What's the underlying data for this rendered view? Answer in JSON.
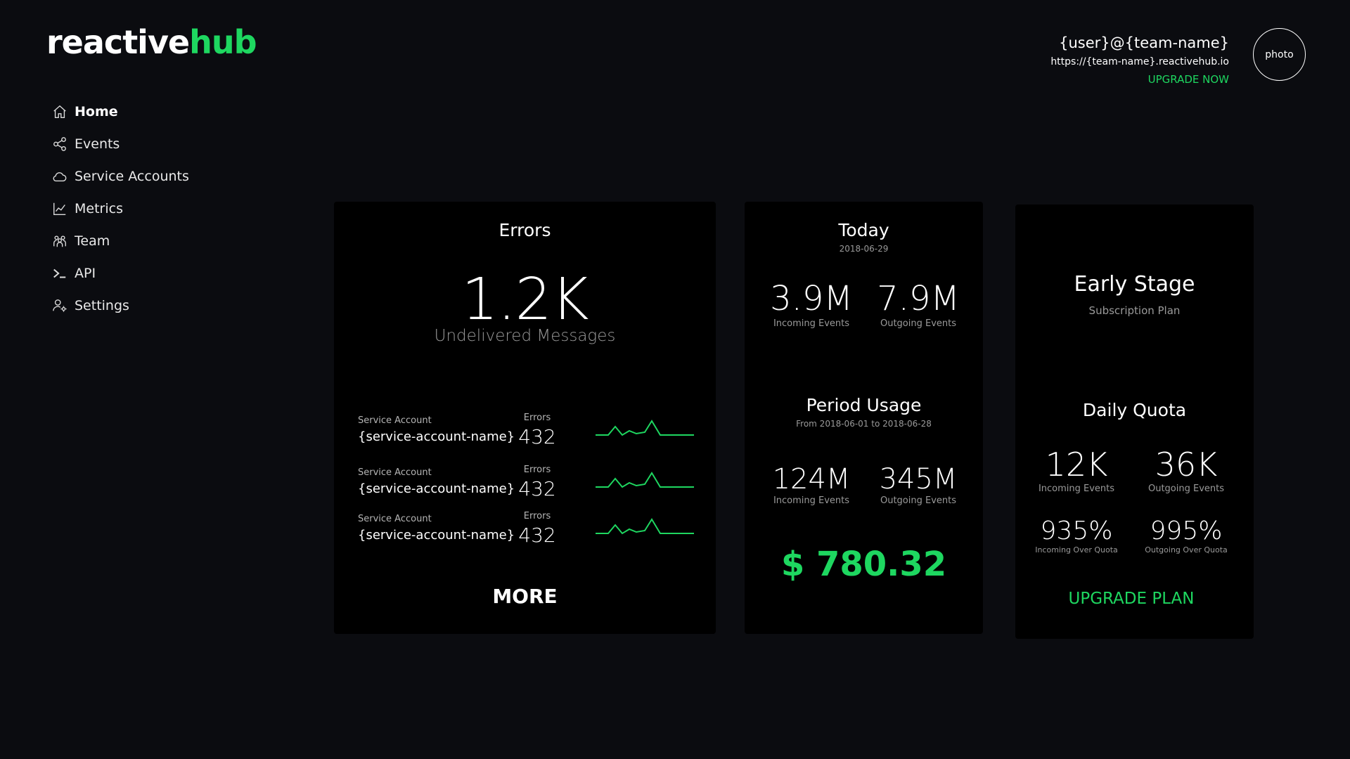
{
  "logo": {
    "part1": "reactive",
    "part2": "hub"
  },
  "sidebar": {
    "items": [
      {
        "label": "Home",
        "icon": "home-icon"
      },
      {
        "label": "Events",
        "icon": "share-icon"
      },
      {
        "label": "Service Accounts",
        "icon": "cloud-icon"
      },
      {
        "label": "Metrics",
        "icon": "chart-line-icon"
      },
      {
        "label": "Team",
        "icon": "team-icon"
      },
      {
        "label": "API",
        "icon": "terminal-icon"
      },
      {
        "label": "Settings",
        "icon": "user-settings-icon"
      }
    ],
    "active": "Home"
  },
  "user": {
    "name": "{user}@{team-name}",
    "url": "https://{team-name}.reactivehub.io",
    "upgrade": "UPGRADE NOW",
    "photo": "photo"
  },
  "errors": {
    "title": "Errors",
    "count": "1.2K",
    "subtitle": "Undelivered Messages",
    "rows": [
      {
        "account_label": "Service Account",
        "account_name": "{service-account-name}",
        "errors_label": "Errors",
        "errors_value": "432"
      },
      {
        "account_label": "Service Account",
        "account_name": "{service-account-name}",
        "errors_label": "Errors",
        "errors_value": "432"
      },
      {
        "account_label": "Service Account",
        "account_name": "{service-account-name}",
        "errors_label": "Errors",
        "errors_value": "432"
      }
    ],
    "more": "MORE"
  },
  "today": {
    "title": "Today",
    "date": "2018-06-29",
    "incoming_value": "3.9M",
    "incoming_label": "Incoming Events",
    "outgoing_value": "7.9M",
    "outgoing_label": "Outgoing Events"
  },
  "period": {
    "title": "Period Usage",
    "range": "From 2018-06-01 to 2018-06-28",
    "incoming_value": "124M",
    "incoming_label": "Incoming Events",
    "outgoing_value": "345M",
    "outgoing_label": "Outgoing Events",
    "cost": "$ 780.32"
  },
  "plan": {
    "name": "Early Stage",
    "subtitle": "Subscription Plan",
    "quota_title": "Daily Quota",
    "incoming_value": "12K",
    "incoming_label": "Incoming Events",
    "outgoing_value": "36K",
    "outgoing_label": "Outgoing Events",
    "incoming_over_value": "935%",
    "incoming_over_label": "Incoming Over Quota",
    "outgoing_over_value": "995%",
    "outgoing_over_label": "Outgoing Over Quota",
    "upgrade": "UPGRADE PLAN"
  },
  "colors": {
    "background": "#0b0c10",
    "card": "#000000",
    "accent": "#1ed760"
  }
}
